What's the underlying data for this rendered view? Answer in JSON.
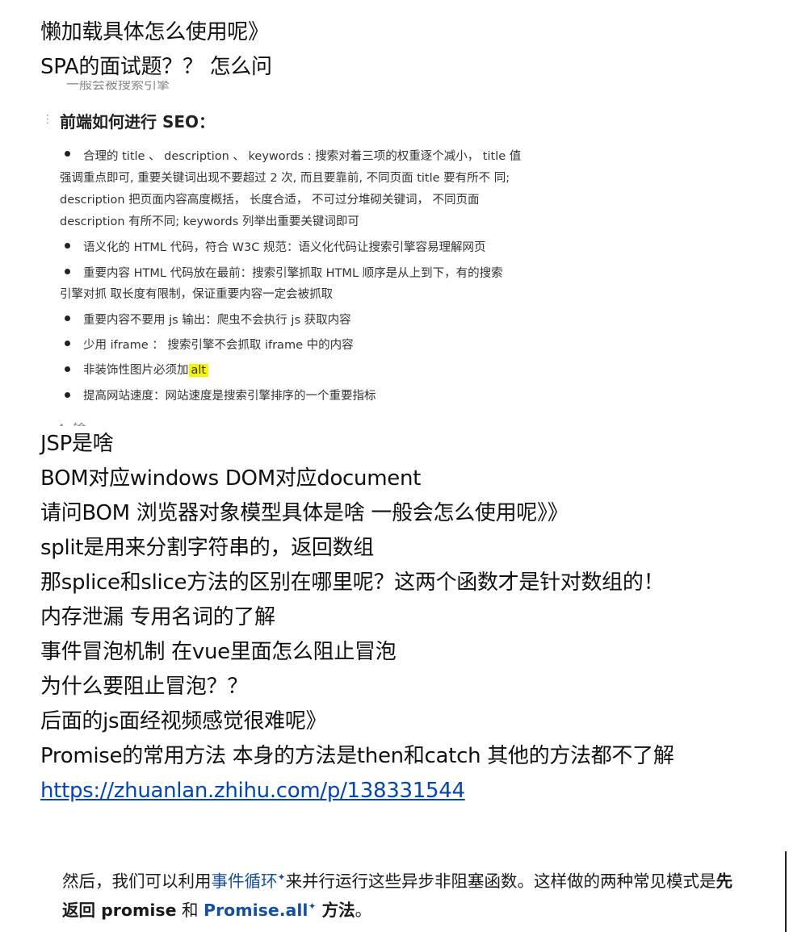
{
  "notes_top": [
    "懒加载具体怎么使用呢》",
    "SPA的面试题？？ 怎么问"
  ],
  "embedded_screenshot_1": {
    "cut_top_text": "一般会被搜索引擎",
    "heading": "前端如何进行 SEO：",
    "drag_handle": "⋮",
    "bullet_1_lines": [
      "合理的  title  、 description  、 keywords  : 搜索对着三项的权重逐个减小，  title  值",
      "强调重点即可, 重要关键词出现不要超过 2 次, 而且要靠前, 不同页面  title  要有所不  同;",
      "description  把页面内容高度概括，  长度合适，  不可过分堆砌关键词，  不同页面",
      "description  有所不同;     keywords  列举出重要关键词即可"
    ],
    "bullet_2": "语义化的  HTML  代码，符合  W3C  规范：语义化代码让搜索引擎容易理解网页",
    "bullet_3_lines": [
      "重要内容  HTML  代码放在最前：搜索引擎抓取  HTML  顺序是从上到下，有的搜索",
      "引擎对抓  取长度有限制，保证重要内容一定会被抓取"
    ],
    "bullet_4": "重要内容不要用  js  输出：爬虫不会执行  js 获取内容",
    "bullet_5": "少用  iframe  ：  搜索引擎不会抓取  iframe  中的内容",
    "bullet_6_prefix": "非装饰性图片必须加",
    "bullet_6_highlight": "alt",
    "bullet_7": "提高网站速度：网站速度是搜索引擎排序的一个重要指标",
    "cut_bottom_text": "4. 输"
  },
  "notes_middle": [
    "JSP是啥",
    "BOM对应windows   DOM对应document",
    "请问BOM 浏览器对象模型具体是啥 一般会怎么使用呢》》",
    "split是用来分割字符串的，返回数组",
    "那splice和slice方法的区别在哪里呢？这两个函数才是针对数组的！",
    "内存泄漏 专用名词的了解",
    "事件冒泡机制     在vue里面怎么阻止冒泡",
    "为什么要阻止冒泡？？",
    "后面的js面经视频感觉很难呢》",
    "Promise的常用方法 本身的方法是then和catch 其他的方法都不了解"
  ],
  "link": "https://zhuanlan.zhihu.com/p/138331544",
  "embedded_screenshot_2": {
    "line1_a": "然后，我们可以利用",
    "line1_link": "事件循环",
    "line1_b": "来并行运行这些异步非阻塞函数。这样做的两种常见模式是",
    "line1_bold": "先",
    "line2_bold_a": "返回 promise",
    "line2_mid": " 和 ",
    "line2_link": "Promise.all",
    "line2_bold_b": " 方法",
    "line2_end": "。",
    "sup_mark": "✦"
  }
}
